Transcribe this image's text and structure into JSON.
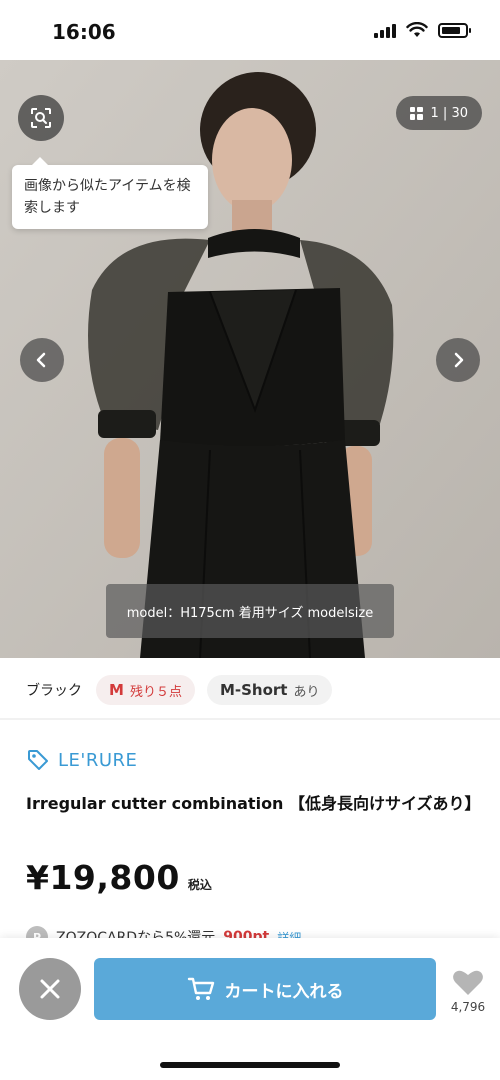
{
  "status_bar": {
    "time": "16:06"
  },
  "gallery": {
    "counter": "1 | 30",
    "image_search_tooltip": "画像から似たアイテムを検索します",
    "model_caption": "model：H175cm 着用サイズ modelsize"
  },
  "variant": {
    "color": "ブラック",
    "chips": [
      {
        "size": "M",
        "status": "残り５点"
      },
      {
        "size": "M-Short",
        "status": "あり"
      }
    ]
  },
  "product": {
    "brand": "LE'RURE",
    "name": "Irregular cutter combination 【低身長向けサイズあり】",
    "price": "¥19,800",
    "tax_label": "税込",
    "zozocard_badge": "P",
    "zozocard_text": "ZOZOCARDなら5%還元",
    "zozocard_points": "900pt",
    "zozocard_link": "詳細"
  },
  "actions": {
    "cart_label": "カートに入れる",
    "favorite_count": "4,796"
  },
  "colors": {
    "accent_blue": "#5aa9d9",
    "brand_blue": "#3a9ad4",
    "alert_red": "#d33a3a",
    "close_gray": "#9a9a9a"
  },
  "icons": [
    "image-search-icon",
    "grid-icon",
    "chevron-left-icon",
    "chevron-right-icon",
    "tag-icon",
    "close-icon",
    "cart-icon",
    "heart-icon"
  ]
}
